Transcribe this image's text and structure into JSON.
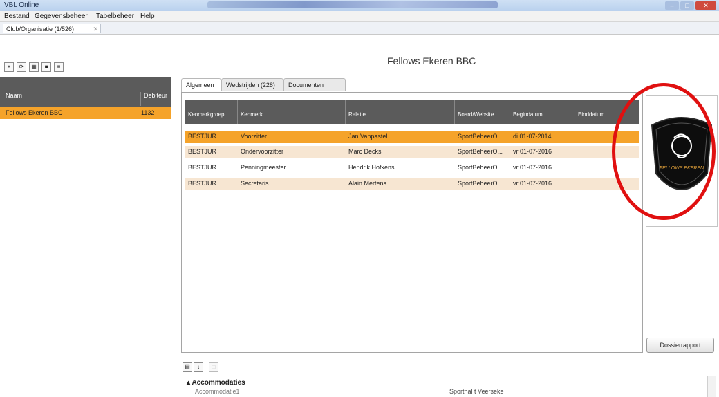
{
  "window": {
    "title": "VBL Online"
  },
  "menu": [
    "Bestand",
    "Gegevensbeheer",
    "Tabelbeheer",
    "Help"
  ],
  "document_tab": {
    "label": "Club/Organisatie (1/526)"
  },
  "org_title": "Fellows Ekeren BBC",
  "left_list": {
    "columns": [
      "Naam",
      "Debiteur"
    ],
    "rows": [
      {
        "naam": "Fellows Ekeren BBC",
        "debiteur": "1132"
      }
    ]
  },
  "tabs": [
    "Algemeen",
    "Wedstrijden (228)",
    "Documenten"
  ],
  "grid": {
    "columns": [
      "Kenmerkgroep",
      "Kenmerk",
      "Relatie",
      "Board/Website",
      "Begindatum",
      "Einddatum"
    ],
    "rows": [
      [
        "BESTJUR",
        "Voorzitter",
        "Jan Vanpastel",
        "SportBeheerO...",
        "di 01-07-2014",
        ""
      ],
      [
        "BESTJUR",
        "Ondervoorzitter",
        "Marc Decks",
        "SportBeheerO...",
        "vr 01-07-2016",
        ""
      ],
      [
        "BESTJUR",
        "Penningmeester",
        "Hendrik Hofkens",
        "SportBeheerO...",
        "vr 01-07-2016",
        ""
      ],
      [
        "BESTJUR",
        "Secretaris",
        "Alain Mertens",
        "SportBeheerO...",
        "vr 01-07-2016",
        ""
      ]
    ]
  },
  "logo": {
    "text": "FELLOWS EKEREN"
  },
  "report_button": "Dossierrapport",
  "properties": {
    "category": "Accommodaties",
    "item_name": "Accommodatie1",
    "item_value": "Sporthal t Veerseke"
  },
  "colors": {
    "selected_row": "#f5a32a",
    "alt_row": "#f7e6d2",
    "header": "#5b5b5b",
    "annotation": "#e01010"
  }
}
